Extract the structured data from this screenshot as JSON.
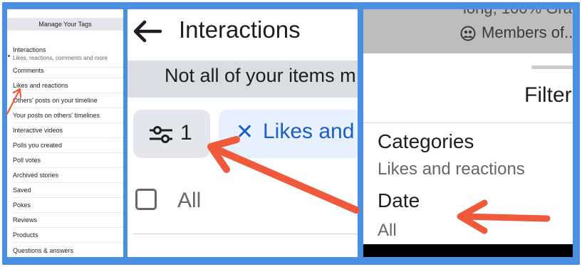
{
  "panel_left": {
    "header": "Manage Your Tags",
    "items": [
      {
        "label": "Interactions",
        "sublabel": "Likes, reactions, comments and more"
      },
      {
        "label": "Comments"
      },
      {
        "label": "Likes and reactions"
      },
      {
        "label": "Others' posts on your timeline"
      },
      {
        "label": "Your posts on others' timelines"
      },
      {
        "label": "Interactive videos"
      },
      {
        "label": "Polls you created"
      },
      {
        "label": "Poll votes"
      },
      {
        "label": "Archived stories"
      },
      {
        "label": "Saved"
      },
      {
        "label": "Pokes"
      },
      {
        "label": "Reviews"
      },
      {
        "label": "Products"
      },
      {
        "label": "Questions & answers"
      }
    ]
  },
  "panel_middle": {
    "back_icon": "arrow-left-icon",
    "title": "Interactions",
    "banner": "Not all of your items m",
    "filter_icon": "sliders-icon",
    "filter_count": "1",
    "chip_icon": "close-icon",
    "chip_label": "Likes and",
    "checkbox_label": "All"
  },
  "panel_right": {
    "top_text": "iong, 100% Gra",
    "members_icon": "group-icon",
    "members_text": "Members of...",
    "sheet_title": "Filter",
    "categories_label": "Categories",
    "categories_value": "Likes and reactions",
    "date_label": "Date",
    "date_value": "All"
  },
  "colors": {
    "frame": "#4a90e2",
    "arrow": "#ef5a3c",
    "chip_bg": "#e7f0fd",
    "chip_text": "#1a5fc7"
  }
}
